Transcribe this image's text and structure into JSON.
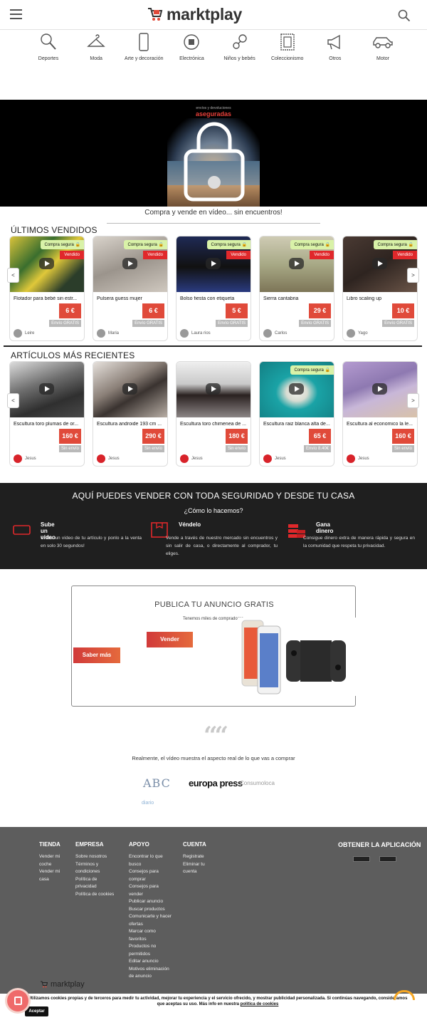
{
  "brand": {
    "name": "marktplay",
    "accent": "#e04a3a"
  },
  "header": {
    "menu_icon": "hamburger-icon",
    "search_icon": "search-icon"
  },
  "categories": [
    {
      "label": "Deportes",
      "icon": "tennis-racket-icon"
    },
    {
      "label": "Moda",
      "icon": "hanger-icon"
    },
    {
      "label": "Arte y decoración",
      "icon": "phone-icon"
    },
    {
      "label": "Electrónica",
      "icon": "plug-icon"
    },
    {
      "label": "Niños y bebés",
      "icon": "pacifier-icon"
    },
    {
      "label": "Coleccionismo",
      "icon": "stamp-icon"
    },
    {
      "label": "Otros",
      "icon": "megaphone-icon"
    },
    {
      "label": "Motor",
      "icon": "car-icon"
    }
  ],
  "banner": {
    "small_text": "envíos y devoluciones",
    "big_text": "aseguradas"
  },
  "tagline": "Compra y vende en vídeo... sin encuentros!",
  "sold": {
    "title": "ÚLTIMOS VENDIDOS",
    "items": [
      {
        "title": "Flotador para bebé sin estr...",
        "price": "6 €",
        "shipping": "Envío GRATIS",
        "user": "Leire",
        "safe": "Compra segura",
        "status": "Vendido"
      },
      {
        "title": "Pulsera guess mujer",
        "price": "6 €",
        "shipping": "Envío GRATIS",
        "user": "Maria",
        "safe": "Compra segura",
        "status": "Vendido"
      },
      {
        "title": "Bolso fiesta con etiqueta",
        "price": "5 €",
        "shipping": "Envío GRATIS",
        "user": "Laura rios",
        "safe": "Compra segura",
        "status": "Vendido"
      },
      {
        "title": "Sierra cantabria",
        "price": "29 €",
        "shipping": "Envío GRATIS",
        "user": "Carlos",
        "safe": "Compra segura",
        "status": "Vendido"
      },
      {
        "title": "Libro scaling up",
        "price": "10 €",
        "shipping": "Envío GRATIS",
        "user": "Yago",
        "safe": "Compra segura",
        "status": "Vendido"
      }
    ]
  },
  "recent": {
    "title": "ARTÍCULOS MÁS RECIENTES",
    "items": [
      {
        "title": "Escultura toro plumas de or...",
        "price": "160 €",
        "shipping": "Sin envío",
        "user": "Jesus"
      },
      {
        "title": "Escultura androide 193 cm ...",
        "price": "290 €",
        "shipping": "Sin envío",
        "user": "Jesus"
      },
      {
        "title": "Escultura toro chimenea de ...",
        "price": "180 €",
        "shipping": "Sin envío",
        "user": "Jesus"
      },
      {
        "title": "Escultura raiz blanca alta de...",
        "price": "65 €",
        "shipping": "Envío 8.40€",
        "user": "Jesus",
        "safe": "Compra segura"
      },
      {
        "title": "Escultura al economico la le...",
        "price": "160 €",
        "shipping": "Sin envío",
        "user": "Jesus"
      }
    ]
  },
  "arrows": {
    "prev": "<",
    "next": ">"
  },
  "security": {
    "title": "AQUÍ PUEDES VENDER CON TODA SEGURIDAD Y DESDE TU CASA",
    "subtitle": "¿Cómo lo hacemos?",
    "features": [
      {
        "title": "Sube un vídeo",
        "desc": "Graba un vídeo de tu artículo y ponlo a la venta en solo 30 segundos!",
        "icon": "video-icon"
      },
      {
        "title": "Véndelo",
        "desc": "Vende a través de nuestro mercado sin encuentros y sin salir de casa, o directamente al comprador, tu eliges.",
        "icon": "box-icon"
      },
      {
        "title": "Gana dinero",
        "desc": "Consigue dinero extra de manera rápida y segura en la comunidad que respeta tu privacidad.",
        "icon": "coins-icon"
      }
    ]
  },
  "promo": {
    "title": "PUBLICA TU ANUNCIO GRATIS",
    "subtitle": "Tenemos miles de compradores",
    "sell_button": "Vender",
    "more_button": "Saber más"
  },
  "testimonial": {
    "text": "Realmente, el vídeo muestra el aspecto real de lo que vas a comprar"
  },
  "press": [
    "ABC",
    "europa press",
    "Consumoloca",
    "diario"
  ],
  "footer": {
    "columns": [
      {
        "title": "TIENDA",
        "links": [
          "Vender mi coche",
          "Vender mi casa"
        ]
      },
      {
        "title": "EMPRESA",
        "links": [
          "Sobre nosotros",
          "Términos y condiciones",
          "Política de privacidad",
          "Política de cookies"
        ]
      },
      {
        "title": "APOYO",
        "links": [
          "Encontrar lo que busco",
          "Consejos para comprar",
          "Consejos para vender",
          "Publicar anuncio",
          "Buscar productos",
          "Comunicarte y hacer ofertas",
          "Marcar como favoritos",
          "Productos no permitidos",
          "Editar anuncio",
          "Motivos eliminación de anuncio"
        ]
      },
      {
        "title": "CUENTA",
        "links": [
          "Registrate",
          "Eliminar tu cuenta"
        ]
      }
    ],
    "app_title": "OBTENER LA APLICACIÓN",
    "logo": "marktplay"
  },
  "cookie": {
    "text": "Utilizamos cookies propias y de terceros para medir tu actividad, mejorar tu experiencia y el servicio ofrecido, y mostrar publicidad personalizada. Si continúas navegando, consideramos que aceptas su uso. Más info en nuestra",
    "link": "política de cookies",
    "accept": "Aceptar"
  }
}
